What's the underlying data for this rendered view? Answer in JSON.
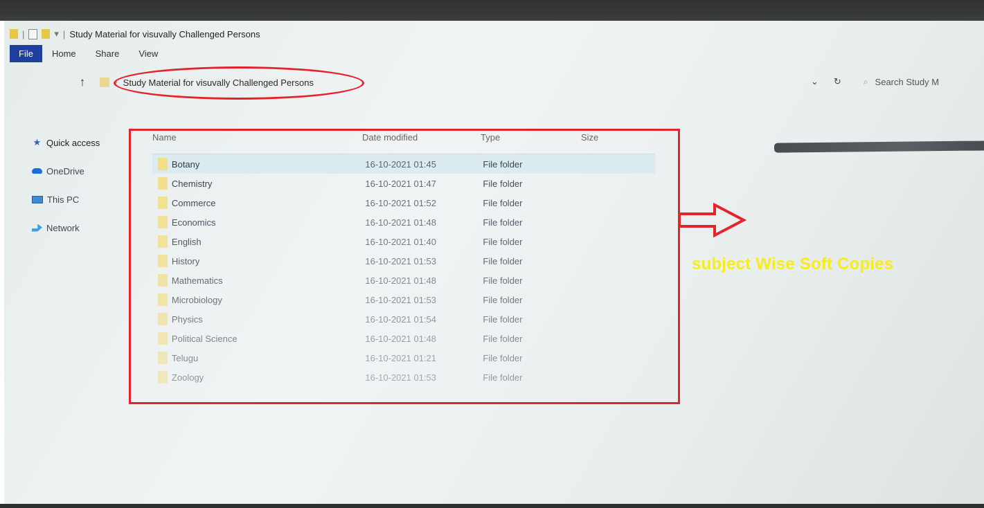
{
  "window": {
    "title": "Study Material for visuvally Challenged Persons",
    "qa_separator": "|",
    "qa_dropdown": "▾"
  },
  "ribbon": {
    "tabs": [
      "File",
      "Home",
      "Share",
      "View"
    ]
  },
  "address_bar": {
    "path": "Study Material for visuvally Challenged Persons",
    "up_icon": "up-arrow-icon",
    "chevron": "›"
  },
  "right_controls": {
    "dropdown": "⌄",
    "refresh": "↻",
    "search_placeholder": "Search Study M"
  },
  "sidebar": {
    "items": [
      {
        "label": "Quick access",
        "icon": "star-icon"
      },
      {
        "label": "OneDrive",
        "icon": "cloud-icon"
      },
      {
        "label": "This PC",
        "icon": "pc-icon"
      },
      {
        "label": "Network",
        "icon": "network-icon"
      }
    ]
  },
  "columns": {
    "name": "Name",
    "date": "Date modified",
    "type": "Type",
    "size": "Size"
  },
  "files": [
    {
      "name": "Botany",
      "date": "16-10-2021 01:45",
      "type": "File folder"
    },
    {
      "name": "Chemistry",
      "date": "16-10-2021 01:47",
      "type": "File folder"
    },
    {
      "name": "Commerce",
      "date": "16-10-2021 01:52",
      "type": "File folder"
    },
    {
      "name": "Economics",
      "date": "16-10-2021 01:48",
      "type": "File folder"
    },
    {
      "name": "English",
      "date": "16-10-2021 01:40",
      "type": "File folder"
    },
    {
      "name": "History",
      "date": "16-10-2021 01:53",
      "type": "File folder"
    },
    {
      "name": "Mathematics",
      "date": "16-10-2021 01:48",
      "type": "File folder"
    },
    {
      "name": "Microbiology",
      "date": "16-10-2021 01:53",
      "type": "File folder"
    },
    {
      "name": "Physics",
      "date": "16-10-2021 01:54",
      "type": "File folder"
    },
    {
      "name": "Political Science",
      "date": "16-10-2021 01:48",
      "type": "File folder"
    },
    {
      "name": "Telugu",
      "date": "16-10-2021 01:21",
      "type": "File folder"
    },
    {
      "name": "Zoology",
      "date": "16-10-2021 01:53",
      "type": "File folder"
    }
  ],
  "annotation": {
    "caption": "subject Wise Soft Copies",
    "highlight_color": "#e4232c",
    "caption_color": "#f7ec20"
  }
}
